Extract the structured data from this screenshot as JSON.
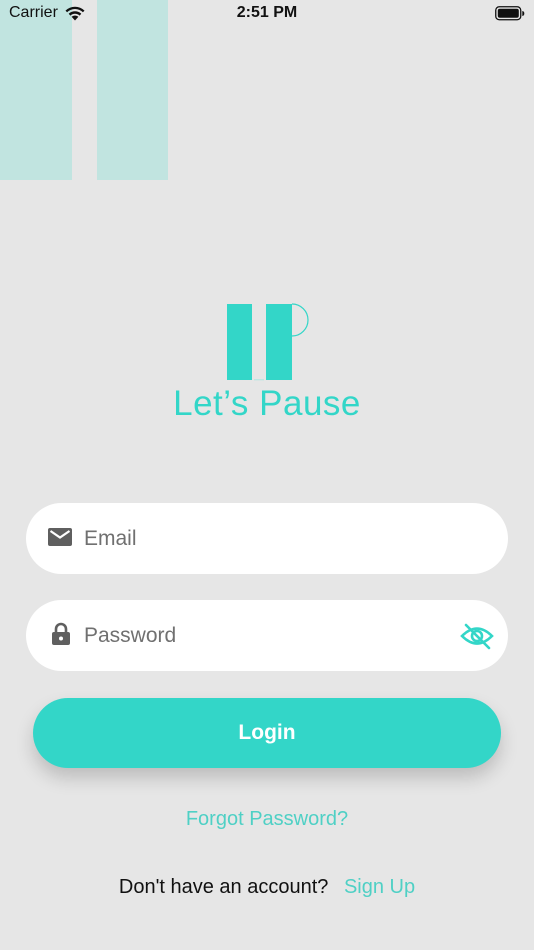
{
  "status_bar": {
    "carrier": "Carrier",
    "time": "2:51 PM"
  },
  "brand": {
    "name": "Let’s Pause",
    "accent_color": "#33d6c8"
  },
  "form": {
    "email": {
      "value": "",
      "placeholder": "Email",
      "icon": "mail-icon"
    },
    "password": {
      "value": "",
      "placeholder": "Password",
      "icon": "lock-icon",
      "toggle_icon": "eye-off-icon"
    },
    "login_label": "Login"
  },
  "links": {
    "forgot_password": "Forgot Password?",
    "signup_prompt": "Don't have an account?",
    "signup_label": "Sign Up"
  }
}
